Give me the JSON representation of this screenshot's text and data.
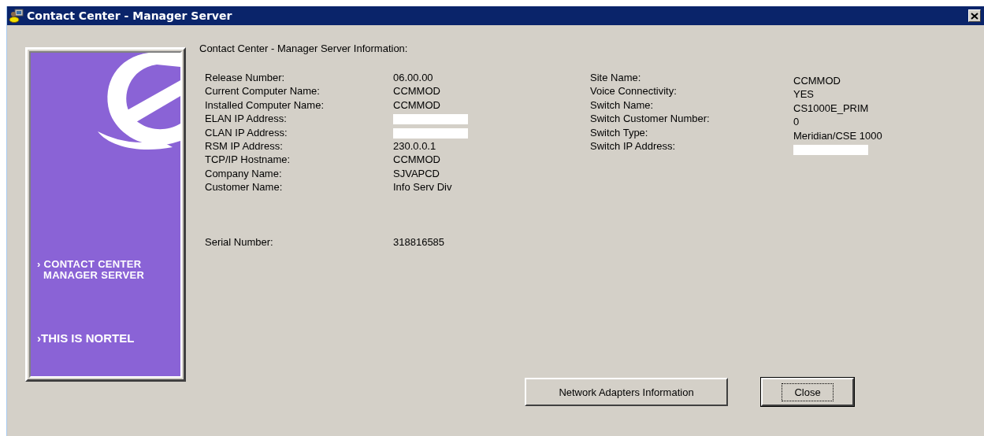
{
  "window": {
    "title": "Contact Center - Manager Server"
  },
  "banner": {
    "product_lines": [
      "› CONTACT CENTER",
      "MANAGER SERVER"
    ],
    "tagline": "›THIS IS NORTEL"
  },
  "heading": "Contact Center - Manager Server Information:",
  "left_info": [
    {
      "label": "Release Number:",
      "value": "06.00.00",
      "redacted": false
    },
    {
      "label": "Current Computer Name:",
      "value": "CCMMOD",
      "redacted": false
    },
    {
      "label": "Installed Computer Name:",
      "value": "CCMMOD",
      "redacted": false
    },
    {
      "label": "ELAN IP Address:",
      "redacted": true
    },
    {
      "label": "CLAN IP Address:",
      "redacted": true
    },
    {
      "label": "RSM IP Address:",
      "value": "230.0.0.1",
      "redacted": false
    },
    {
      "label": "TCP/IP Hostname:",
      "value": "CCMMOD",
      "redacted": false
    },
    {
      "label": "Company Name:",
      "value": "SJVAPCD",
      "redacted": false
    },
    {
      "label": "Customer Name:",
      "value": "Info Serv Div",
      "redacted": false
    }
  ],
  "serial": {
    "label": "Serial Number:",
    "value": "318816585"
  },
  "right_info": [
    {
      "label": "Site Name:",
      "value": "CCMMOD",
      "redacted": false
    },
    {
      "label": "Voice Connectivity:",
      "value": "YES",
      "redacted": false
    },
    {
      "label": "Switch Name:",
      "value": "CS1000E_PRIM",
      "redacted": false
    },
    {
      "label": "Switch Customer Number:",
      "value": "0",
      "redacted": false
    },
    {
      "label": "Switch Type:",
      "value": "Meridian/CSE 1000",
      "redacted": false
    },
    {
      "label": "Switch IP Address:",
      "redacted": true
    }
  ],
  "buttons": [
    {
      "label": "Network Adapters Information",
      "focused": false
    },
    {
      "label": "Close",
      "focused": true
    }
  ]
}
